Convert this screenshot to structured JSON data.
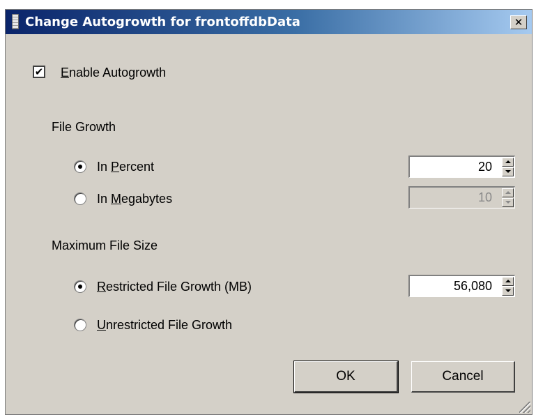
{
  "window": {
    "title": "Change Autogrowth for frontoffdbData",
    "close_glyph": "✕",
    "title_icon": "database-icon"
  },
  "enable_autogrowth": {
    "checked": true,
    "mark": "✔",
    "mnemonic": "E",
    "label_rest": "nable Autogrowth"
  },
  "file_growth": {
    "heading": "File Growth",
    "percent": {
      "selected": true,
      "prefix": "In ",
      "mnemonic": "P",
      "rest": "ercent",
      "value": "20"
    },
    "megabytes": {
      "selected": false,
      "prefix": "In ",
      "mnemonic": "M",
      "rest": "egabytes",
      "value": "10",
      "disabled": true
    }
  },
  "max_file_size": {
    "heading": "Maximum File Size",
    "restricted": {
      "selected": true,
      "mnemonic": "R",
      "rest": "estricted File Growth (MB)",
      "value": "56,080"
    },
    "unrestricted": {
      "selected": false,
      "mnemonic": "U",
      "rest": "nrestricted File Growth"
    }
  },
  "buttons": {
    "ok": "OK",
    "cancel": "Cancel"
  }
}
